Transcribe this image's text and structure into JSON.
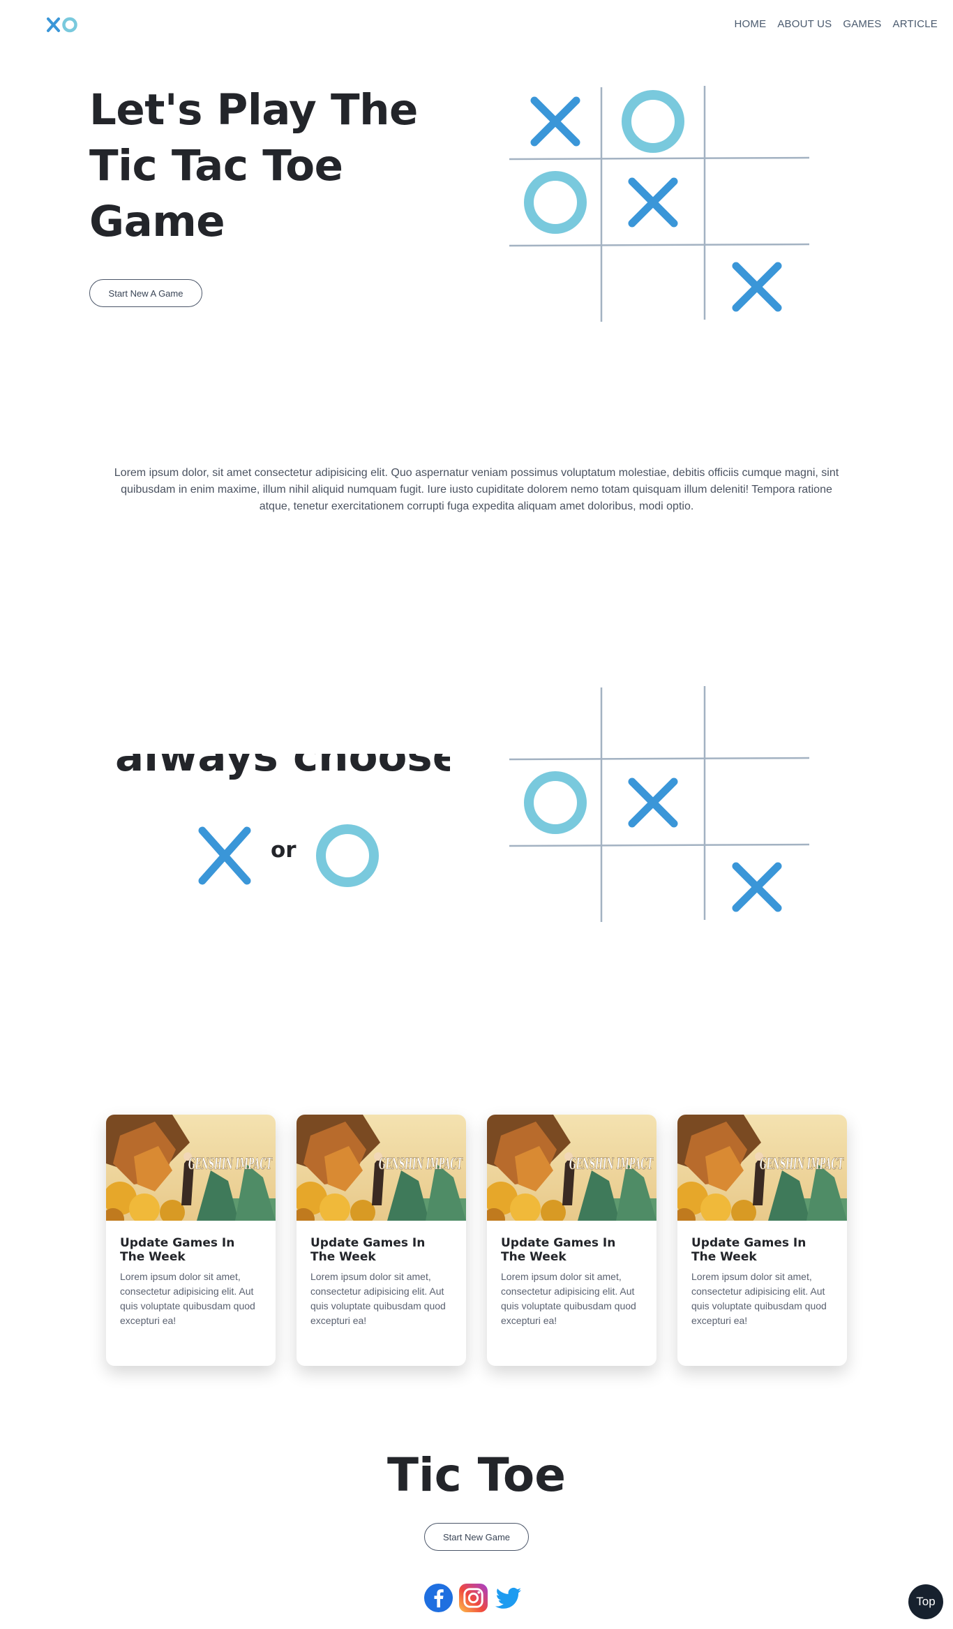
{
  "header": {
    "logo_icon": "xo-logo-icon",
    "nav": [
      {
        "label": "HOME"
      },
      {
        "label": "ABOUT US"
      },
      {
        "label": "GAMES"
      },
      {
        "label": "ARTICLE"
      }
    ]
  },
  "hero": {
    "title": "Let's Play The Tic Tac Toe Game",
    "button_label": "Start New A Game",
    "board": [
      [
        "X",
        "O",
        ""
      ],
      [
        "O",
        "X",
        ""
      ],
      [
        "",
        "",
        "X"
      ]
    ]
  },
  "intro": {
    "text": "Lorem ipsum dolor, sit amet consectetur adipisicing elit. Quo aspernatur veniam possimus voluptatum molestiae, debitis officiis cumque magni, sint quibusdam in enim maxime, illum nihil aliquid numquam fugit. Iure iusto cupiditate dolorem nemo totam quisquam illum deleniti! Tempora ratione atque, tenetur exercitationem corrupti fuga expedita aliquam amet doloribus, modi optio."
  },
  "choose": {
    "heading_partial": "always choose?",
    "or_label": "or",
    "board": [
      [
        "",
        "",
        ""
      ],
      [
        "O",
        "X",
        ""
      ],
      [
        "",
        "",
        "X"
      ]
    ]
  },
  "cards": [
    {
      "image_label": "GENSHIN IMPACT",
      "title": "Update Games In The Week",
      "text": "Lorem ipsum dolor sit amet, consectetur adipisicing elit. Aut quis voluptate quibusdam quod excepturi ea!"
    },
    {
      "image_label": "GENSHIN IMPACT",
      "title": "Update Games In The Week",
      "text": "Lorem ipsum dolor sit amet, consectetur adipisicing elit. Aut quis voluptate quibusdam quod excepturi ea!"
    },
    {
      "image_label": "GENSHIN IMPACT",
      "title": "Update Games In The Week",
      "text": "Lorem ipsum dolor sit amet, consectetur adipisicing elit. Aut quis voluptate quibusdam quod excepturi ea!"
    },
    {
      "image_label": "GENSHIN IMPACT",
      "title": "Update Games In The Week",
      "text": "Lorem ipsum dolor sit amet, consectetur adipisicing elit. Aut quis voluptate quibusdam quod excepturi ea!"
    }
  ],
  "footer": {
    "title": "Tic Toe",
    "button_label": "Start New Game",
    "socials": [
      {
        "icon": "facebook-icon"
      },
      {
        "icon": "instagram-icon"
      },
      {
        "icon": "twitter-icon"
      }
    ],
    "top_label": "Top"
  },
  "colors": {
    "x_mark": "#3a96d8",
    "o_mark": "#79c9dd",
    "grid_line": "#a3b2c2",
    "text_dark": "#23252a",
    "top_button_bg": "#17212e"
  }
}
